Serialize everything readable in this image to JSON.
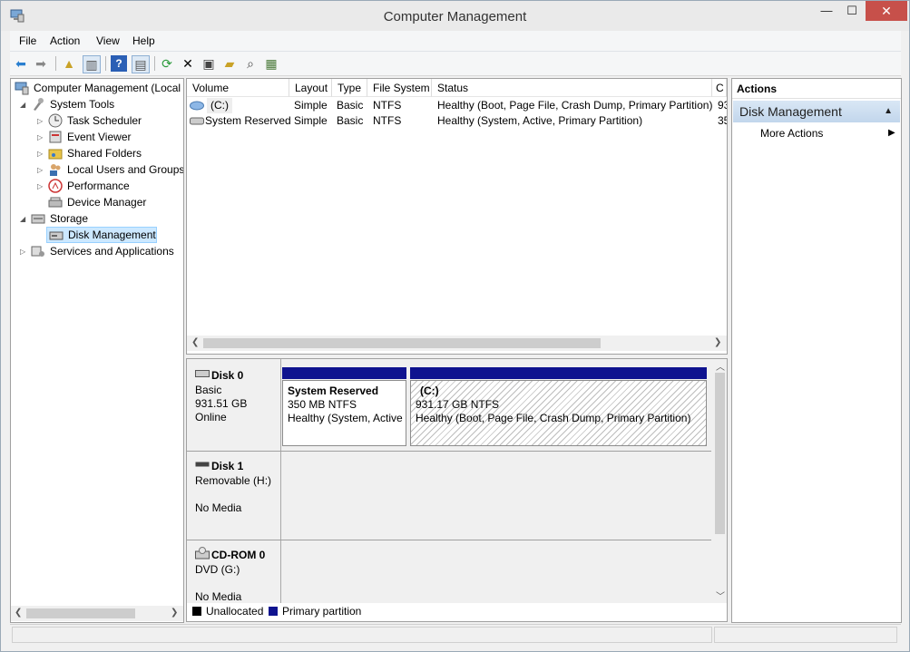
{
  "window": {
    "title": "Computer Management",
    "minimize": "—",
    "maximize": "☐",
    "close": "✕"
  },
  "menu": [
    "File",
    "Action",
    "View",
    "Help"
  ],
  "tree": {
    "root": "Computer Management (Local",
    "system_tools": "System Tools",
    "task_scheduler": "Task Scheduler",
    "event_viewer": "Event Viewer",
    "shared_folders": "Shared Folders",
    "local_users": "Local Users and Groups",
    "performance": "Performance",
    "device_manager": "Device Manager",
    "storage": "Storage",
    "disk_management": "Disk Management",
    "services": "Services and Applications"
  },
  "volumes": {
    "columns": [
      "Volume",
      "Layout",
      "Type",
      "File System",
      "Status",
      "C"
    ],
    "rows": [
      {
        "volume": "(C:)",
        "layout": "Simple",
        "type": "Basic",
        "fs": "NTFS",
        "status": "Healthy (Boot, Page File, Crash Dump, Primary Partition)",
        "cap": "93"
      },
      {
        "volume": "System Reserved",
        "layout": "Simple",
        "type": "Basic",
        "fs": "NTFS",
        "status": "Healthy (System, Active, Primary Partition)",
        "cap": "35"
      }
    ]
  },
  "disks": {
    "disk0": {
      "name": "Disk 0",
      "type": "Basic",
      "size": "931.51 GB",
      "state": "Online"
    },
    "part_reserved": {
      "name": "System Reserved",
      "size": "350 MB NTFS",
      "status": "Healthy (System, Active"
    },
    "part_c": {
      "name": "(C:)",
      "size": "931.17 GB NTFS",
      "status": "Healthy (Boot, Page File, Crash Dump, Primary Partition)"
    },
    "disk1": {
      "name": "Disk 1",
      "type": "Removable (H:)",
      "state": "No Media"
    },
    "cdrom": {
      "name": "CD-ROM 0",
      "type": "DVD (G:)",
      "state": "No Media"
    }
  },
  "legend": {
    "unallocated": "Unallocated",
    "primary": "Primary partition",
    "unallocated_color": "#000000",
    "primary_color": "#0f138f"
  },
  "actions": {
    "title": "Actions",
    "section": "Disk Management",
    "more": "More Actions"
  }
}
